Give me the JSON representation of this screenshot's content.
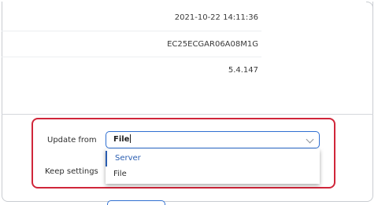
{
  "device_info": {
    "datetime": "2021-10-22 14:11:36",
    "serial": "EC25ECGAR06A08M1G",
    "version": "5.4.147"
  },
  "firmware_update": {
    "update_from_label": "Update from",
    "update_from_value": "File",
    "keep_settings_label": "Keep settings",
    "options": [
      "Server",
      "File"
    ],
    "highlighted_option": "Server"
  },
  "colors": {
    "highlight_border": "#d0263a",
    "focus_blue": "#2f6fd1",
    "selected_option": "#2a5db0"
  },
  "icons": {
    "dropdown": "chevron-down-icon"
  }
}
